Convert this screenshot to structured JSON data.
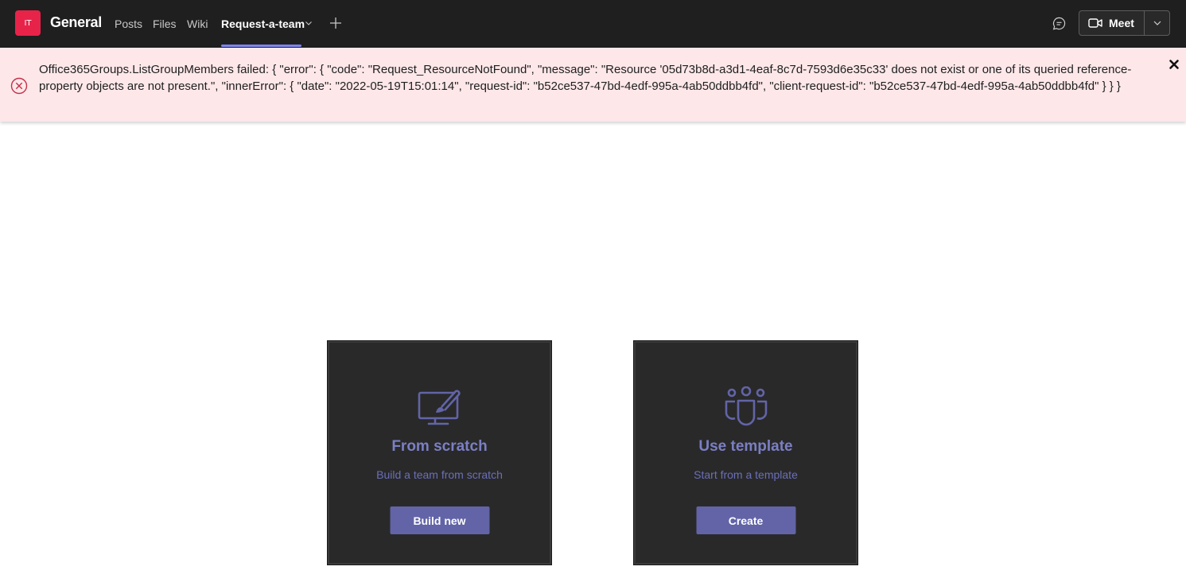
{
  "header": {
    "team_avatar_initials": "IT",
    "channel_title": "General",
    "tabs": [
      {
        "label": "Posts"
      },
      {
        "label": "Files"
      },
      {
        "label": "Wiki"
      },
      {
        "label": "Request-a-team",
        "active": true
      }
    ],
    "meet_label": "Meet",
    "icons": [
      "chevron-down-icon",
      "plus-icon",
      "chat-icon",
      "video-camera-icon"
    ]
  },
  "error": {
    "message": "Office365Groups.ListGroupMembers failed: { \"error\": { \"code\": \"Request_ResourceNotFound\", \"message\": \"Resource '05d73b8d-a3d1-4eaf-8c7d-7593d6e35c33' does not exist or one of its queried reference-property objects are not present.\", \"innerError\": { \"date\": \"2022-05-19T15:01:14\", \"request-id\": \"b52ce537-47bd-4edf-995a-4ab50ddbb4fd\", \"client-request-id\": \"b52ce537-47bd-4edf-995a-4ab50ddbb4fd\" } } }"
  },
  "cards": [
    {
      "title": "From scratch",
      "subtitle": "Build a team from scratch",
      "button": "Build new",
      "icon": "monitor-brush-icon"
    },
    {
      "title": "Use template",
      "subtitle": "Start from a template",
      "button": "Create",
      "icon": "teams-people-icon"
    }
  ],
  "colors": {
    "topbar": "#1f1f1f",
    "accent": "#6264a7",
    "tab_underline": "#7f85f5",
    "avatar": "#e8234a",
    "error_bg": "#fde7e9",
    "error_icon": "#c4314b",
    "card_bg": "#292929"
  }
}
